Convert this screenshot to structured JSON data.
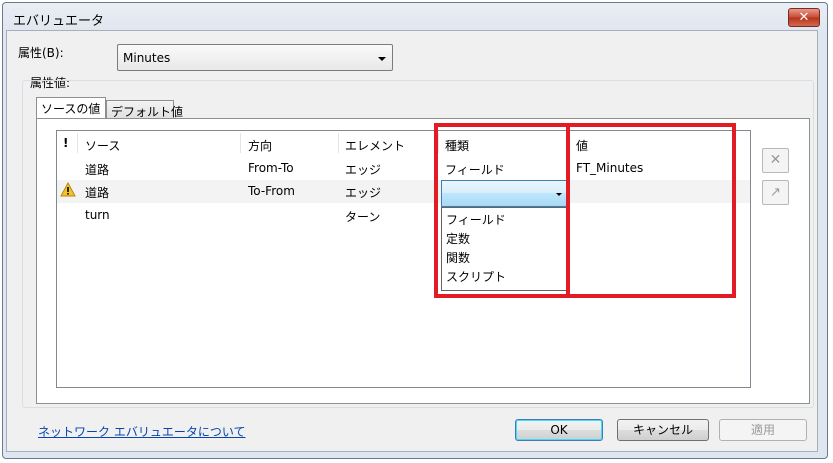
{
  "window": {
    "title": "エバリュエータ",
    "close_glyph": "✕"
  },
  "attribute": {
    "label": "属性(B):",
    "selected": "Minutes"
  },
  "attribute_values": {
    "label": "属性値:"
  },
  "tabs": [
    {
      "label": "ソースの値",
      "active": true
    },
    {
      "label": "デフォルト値",
      "active": false
    }
  ],
  "table": {
    "columns": {
      "warn": "!",
      "source": "ソース",
      "direction": "方向",
      "element": "エレメント",
      "type": "種類",
      "value": "値"
    },
    "rows": [
      {
        "warn_icon": "",
        "source": "道路",
        "direction": "From-To",
        "element": "エッジ",
        "type": "フィールド",
        "value": "FT_Minutes"
      },
      {
        "warn_icon": "warning-icon",
        "source": "道路",
        "direction": "To-From",
        "element": "エッジ",
        "type": "",
        "value": ""
      },
      {
        "warn_icon": "",
        "source": "turn",
        "direction": "",
        "element": "ターン",
        "type": "",
        "value": ""
      }
    ]
  },
  "type_dropdown": {
    "options": [
      "フィールド",
      "定数",
      "関数",
      "スクリプト"
    ]
  },
  "side_buttons": {
    "clear_glyph": "✕",
    "properties_glyph": "↗"
  },
  "footer": {
    "link": "ネットワーク エバリュエータについて",
    "ok": "OK",
    "cancel": "キャンセル",
    "apply": "適用"
  },
  "colors": {
    "highlight": "#e21c25",
    "selection": "#a7d9f5",
    "link": "#0645ad"
  }
}
